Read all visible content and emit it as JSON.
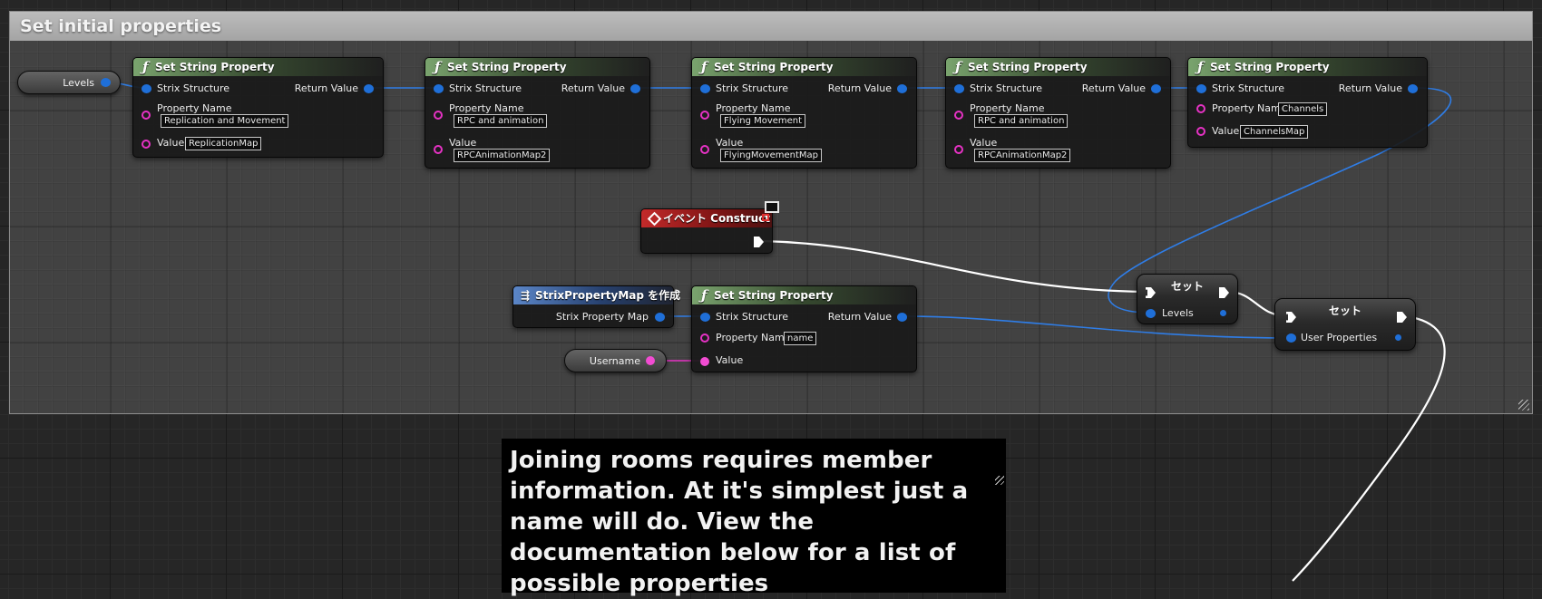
{
  "comment": {
    "title": "Set initial properties"
  },
  "nodes": {
    "levels_var": {
      "label": "Levels"
    },
    "ssp1": {
      "title": "Set String Property",
      "strix": "Strix Structure",
      "return": "Return Value",
      "prop_label": "Property Name",
      "prop_value": "Replication and Movement",
      "value_label": "Value",
      "value_value": "ReplicationMap"
    },
    "ssp2": {
      "title": "Set String Property",
      "strix": "Strix Structure",
      "return": "Return Value",
      "prop_label": "Property Name",
      "prop_value": "RPC and animation",
      "value_label": "Value",
      "value_value": "RPCAnimationMap2"
    },
    "ssp3": {
      "title": "Set String Property",
      "strix": "Strix Structure",
      "return": "Return Value",
      "prop_label": "Property Name",
      "prop_value": "Flying Movement",
      "value_label": "Value",
      "value_value": "FlyingMovementMap"
    },
    "ssp4": {
      "title": "Set String Property",
      "strix": "Strix Structure",
      "return": "Return Value",
      "prop_label": "Property Name",
      "prop_value": "RPC and animation",
      "value_label": "Value",
      "value_value": "RPCAnimationMap2"
    },
    "ssp5": {
      "title": "Set String Property",
      "strix": "Strix Structure",
      "return": "Return Value",
      "prop_label": "Property Name",
      "prop_value": "Channels",
      "value_label": "Value",
      "value_value": "ChannelsMap"
    },
    "event": {
      "title": "イベント Construct",
      "icon": "event-diamond-icon"
    },
    "make_map": {
      "title": "StrixPropertyMap を作成",
      "output": "Strix Property Map"
    },
    "ssp6": {
      "title": "Set String Property",
      "strix": "Strix Structure",
      "return": "Return Value",
      "prop_label": "Property Name",
      "prop_value": "name",
      "value_label": "Value"
    },
    "username_var": {
      "label": "Username"
    },
    "set1": {
      "title": "セット",
      "pin": "Levels"
    },
    "set2": {
      "title": "セット",
      "pin": "User Properties"
    }
  },
  "note": {
    "text": "Joining rooms requires member information. At it's simplest just a name will do. View the documentation below for a list of possible properties"
  },
  "colors": {
    "struct_pin": "#1f6fd8",
    "string_pin": "#e632c4",
    "exec_wire": "#ffffff",
    "function_header": "#7aa46e",
    "event_header": "#c22a2a",
    "make_header": "#5b86c8"
  }
}
